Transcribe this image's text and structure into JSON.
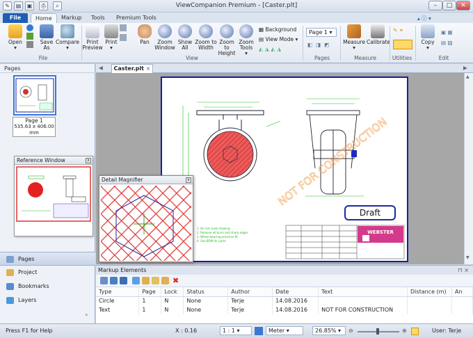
{
  "window": {
    "title": "ViewCompanion Premium - [Caster.plt]"
  },
  "tabs": [
    "File",
    "Home",
    "Markup",
    "Tools",
    "Premium Tools"
  ],
  "ribbon": {
    "file_group": {
      "open": "Open",
      "save_as": "Save As",
      "compare": "Compare",
      "label": "File"
    },
    "view_group": {
      "print_preview": "Print Preview",
      "print": "Print",
      "pan": "Pan",
      "zoom_window": "Zoom Window",
      "show_all": "Show All",
      "zoom_to_width": "Zoom to Width",
      "zoom_to_height": "Zoom to Height",
      "zoom_tools": "Zoom Tools",
      "background": "Background",
      "view_mode": "View Mode",
      "label": "View"
    },
    "pages_group": {
      "page_select": "Page 1",
      "label": "Pages"
    },
    "measure_group": {
      "measure": "Measure",
      "calibrate": "Calibrate",
      "label": "Measure"
    },
    "utilities_group": {
      "label": "Utilities"
    },
    "edit_group": {
      "copy": "Copy",
      "label": "Edit"
    }
  },
  "sidebar": {
    "title": "Pages",
    "thumb_label": "Page 1",
    "thumb_size": "535.63 x 406.00 mm",
    "reference_window": "Reference Window",
    "nav": [
      "Pages",
      "Project",
      "Bookmarks",
      "Layers"
    ]
  },
  "document": {
    "tab": "Caster.plt",
    "watermark": "NOT FOR CONSTRUCTION",
    "stamp": "Draft",
    "logo": "WEBSTER"
  },
  "magnifier": {
    "title": "Detail Magnifier"
  },
  "markup": {
    "title": "Markup Elements",
    "columns": [
      "Type",
      "Page",
      "Lock",
      "Status",
      "Author",
      "Date",
      "Text",
      "Distance (m)",
      "An"
    ],
    "rows": [
      [
        "Circle",
        "1",
        "N",
        "None",
        "Terje",
        "14.08.2016",
        "",
        "",
        ""
      ],
      [
        "Text",
        "1",
        "N",
        "None",
        "Terje",
        "14.08.2016",
        "NOT FOR CONSTRUCTION",
        "",
        ""
      ]
    ]
  },
  "statusbar": {
    "help": "Press F1 for Help",
    "coord": "X : 0.16",
    "scale": "1 : 1",
    "unit": "Meter",
    "zoom": "26.85%",
    "user": "User: Terje"
  },
  "colors": {
    "accent": "#1f5fb3",
    "page_border": "#151ea0",
    "hatch": "#e0303a",
    "watermark": "#f0a050"
  }
}
